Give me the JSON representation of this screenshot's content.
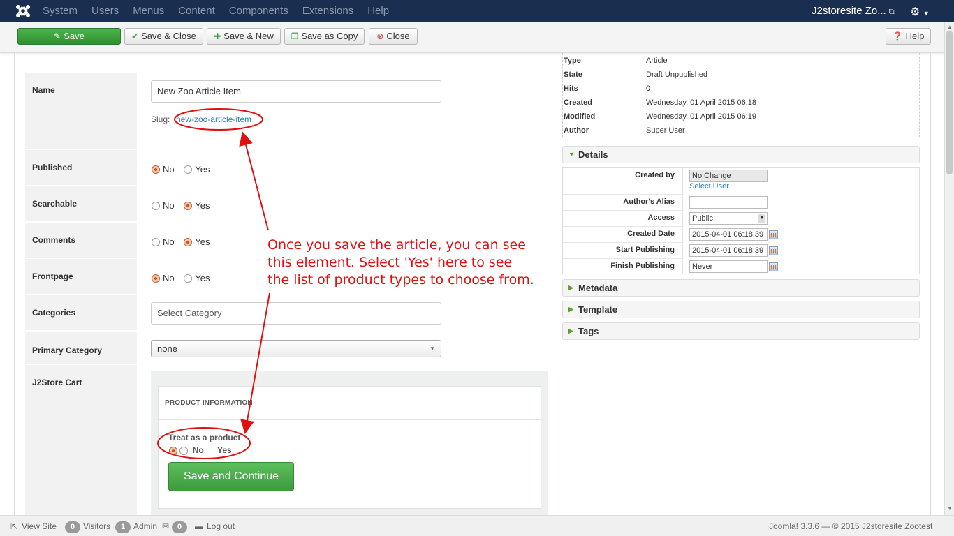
{
  "nav": {
    "menu": [
      "System",
      "Users",
      "Menus",
      "Content",
      "Components",
      "Extensions",
      "Help"
    ],
    "site_title": "J2storesite Zo...",
    "ext_icon": "external-link-icon",
    "settings_icon": "gear-icon"
  },
  "toolbar": {
    "save": "Save",
    "save_close": "Save & Close",
    "save_new": "Save & New",
    "save_copy": "Save as Copy",
    "close": "Close",
    "help": "Help"
  },
  "form": {
    "name_label": "Name",
    "name_value": "New Zoo Article Item",
    "slug_label": "Slug:",
    "slug_value": "new-zoo-article-item",
    "published_label": "Published",
    "searchable_label": "Searchable",
    "comments_label": "Comments",
    "frontpage_label": "Frontpage",
    "categories_label": "Categories",
    "categories_placeholder": "Select Category",
    "primary_category_label": "Primary Category",
    "primary_category_value": "none",
    "j2store_label": "J2Store Cart",
    "opt_no": "No",
    "opt_yes": "Yes",
    "published": "No",
    "searchable": "Yes",
    "comments": "Yes",
    "frontpage": "No"
  },
  "j2store": {
    "heading": "PRODUCT INFORMATION",
    "treat_label": "Treat as a product",
    "opt_no": "No",
    "opt_yes": "Yes",
    "treat_value": "No",
    "button": "Save and Continue"
  },
  "info": [
    {
      "key": "Type",
      "value": "Article"
    },
    {
      "key": "State",
      "value": "Draft Unpublished"
    },
    {
      "key": "Hits",
      "value": "0"
    },
    {
      "key": "Created",
      "value": "Wednesday, 01 April 2015 06:18"
    },
    {
      "key": "Modified",
      "value": "Wednesday, 01 April 2015 06:19"
    },
    {
      "key": "Author",
      "value": "Super User"
    }
  ],
  "details": {
    "title": "Details",
    "created_by_label": "Created by",
    "created_by_value": "No Change",
    "select_user": "Select User",
    "author_alias_label": "Author's Alias",
    "author_alias_value": "",
    "access_label": "Access",
    "access_value": "Public",
    "created_date_label": "Created Date",
    "created_date_value": "2015-04-01 06:18:39",
    "start_publishing_label": "Start Publishing",
    "start_publishing_value": "2015-04-01 06:18:39",
    "finish_publishing_label": "Finish Publishing",
    "finish_publishing_value": "Never"
  },
  "accordions": [
    "Metadata",
    "Template",
    "Tags"
  ],
  "annotation": {
    "line1": "Once you save the article, you can see",
    "line2": "this element. Select 'Yes' here to see",
    "line3": "the list of product types to choose from.",
    "color": "#e01010"
  },
  "status": {
    "view_site": "View Site",
    "visitors_count": "0",
    "visitors": "Visitors",
    "admin_count": "1",
    "admin": "Admin",
    "mail_count": "0",
    "logout": "Log out",
    "version": "Joomla! 3.3.6",
    "copyright": "— © 2015 J2storesite Zootest"
  },
  "colors": {
    "navbar": "#1a2e4f",
    "save_green": "#3d9a3d",
    "link": "#2a80b9",
    "radio_selected": "#c0502a"
  }
}
